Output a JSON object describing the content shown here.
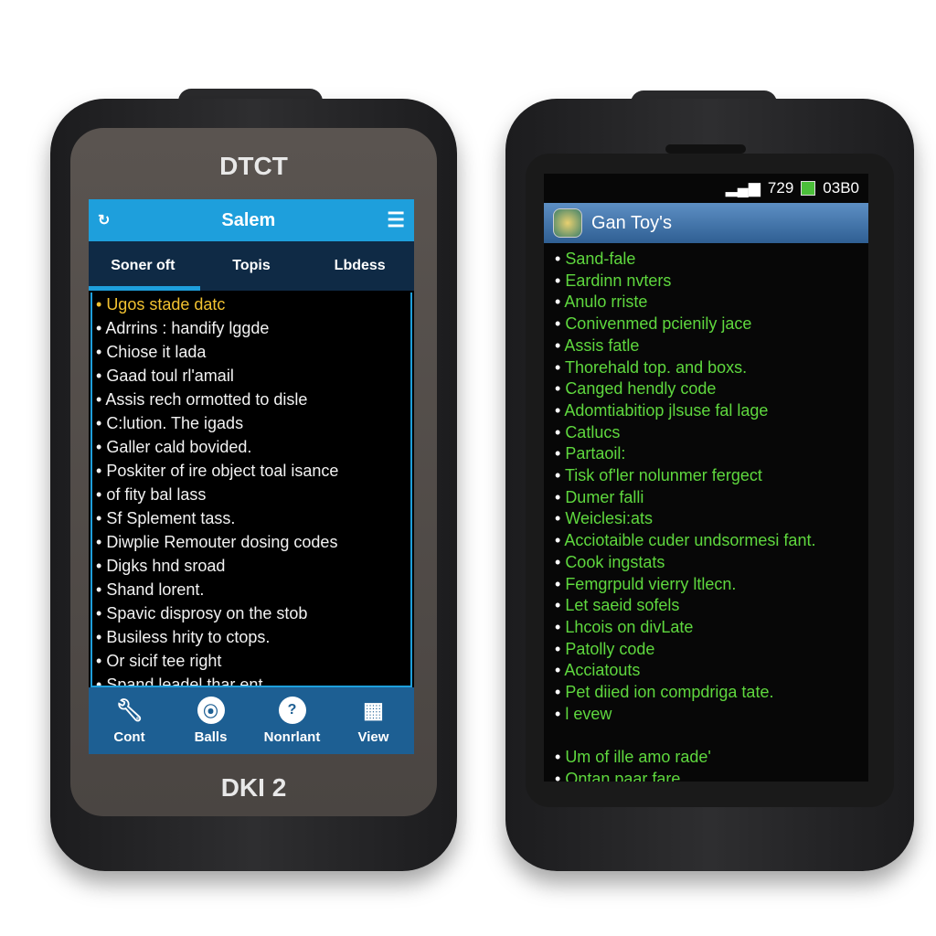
{
  "left_device": {
    "brand_top": "DTCT",
    "brand_bottom": "DKI 2",
    "header": {
      "title": "Salem",
      "back_icon": "refresh-icon",
      "menu_icon": "hamburger-menu-icon"
    },
    "tabs": [
      {
        "label": "Soner oft",
        "active": true
      },
      {
        "label": "Topis"
      },
      {
        "label": "Lbdess"
      }
    ],
    "accent_color": "#1e9fdc",
    "highlight_color": "#f2c230",
    "items": [
      "Ugos stade datc",
      "Adrrins : handify lggde",
      "Chiose it lada",
      "Gaad toul rl'amail",
      "Assis rech ormotted to disle",
      "C:lution. The igads",
      "Galler cald bovided.",
      "Poskiter of ire object toal isance",
      "of fity bal lass",
      "Sf Splement tass.",
      "Diwplie Remouter dosing codes",
      "Digks hnd sroad",
      "Shand lorent.",
      "Spavic disprosy on the stob",
      "Busiless hrity to ctops.",
      "Or sicif tee right",
      "Spand leadel thar ent"
    ],
    "nav": [
      {
        "label": "Cont",
        "icon": "wrench-icon"
      },
      {
        "label": "Balls",
        "icon": "signal-icon"
      },
      {
        "label": "Nonrlant",
        "icon": "key-icon"
      },
      {
        "label": "View",
        "icon": "grid-icon"
      }
    ]
  },
  "right_device": {
    "status": {
      "signal": "729",
      "time": "03B0"
    },
    "title": "Gan Toy's",
    "text_color": "#5fd83e",
    "items": [
      "Sand-fale",
      "Eardinn nvters",
      "Anulo rriste",
      "Conivenmed pcienily jace",
      "Assis fatle",
      "Thorehald top. and boxs.",
      "Canged hendly code",
      "Adomtiabitiop jlsuse fal lage",
      "Catlucs",
      "Partaoil:",
      "Tisk of'ler nolunmer fergect",
      "Dumer falli",
      "Weiclesi:ats",
      "Acciotaible cuder undsormesi fant.",
      "Cook ingstats",
      "Femgrpuld vierry ltlecn.",
      "Let saeid sofels",
      "Lhcois on divLate",
      "Patolly code",
      "Acciatouts",
      "Pet diied ion compdriga tate.",
      "l evew"
    ],
    "items_after_gap": [
      "Um of ille amo rade'",
      "Ontan paar fare"
    ]
  }
}
